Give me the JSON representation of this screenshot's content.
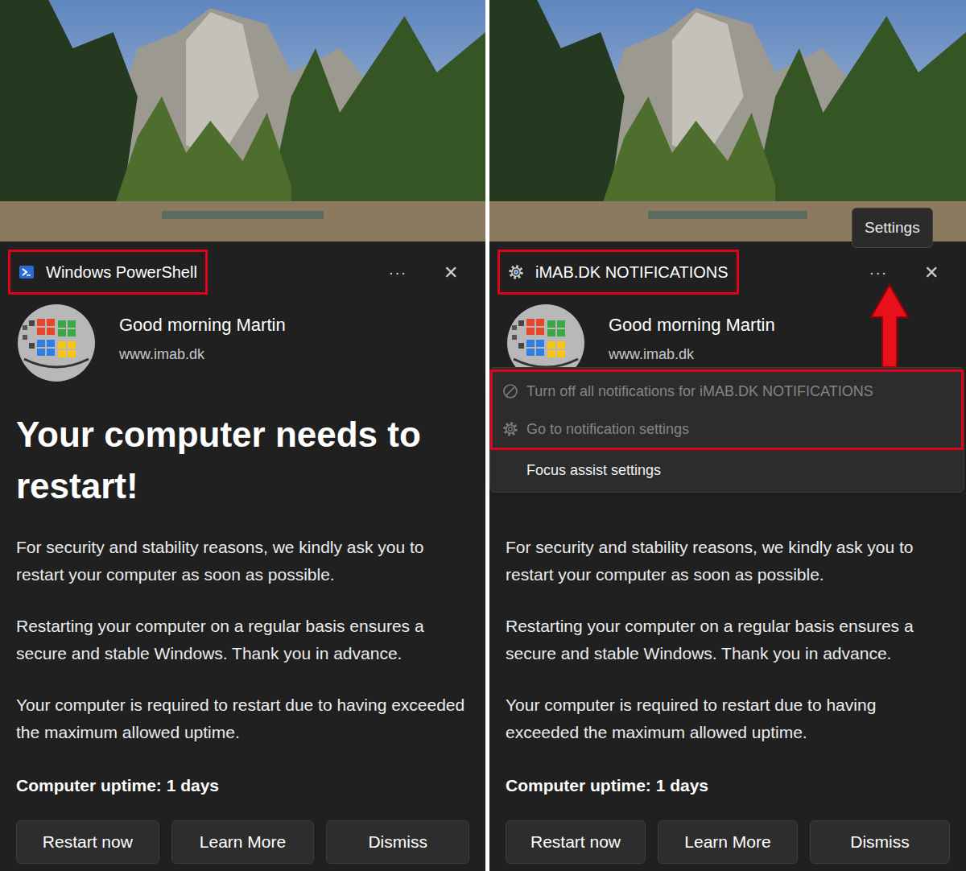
{
  "panels": [
    {
      "kind": "powershell",
      "app_name": "Windows PowerShell",
      "app_highlighted": true,
      "more": "···",
      "close": "✕",
      "sender": "Good morning Martin",
      "site": "www.imab.dk",
      "heading": "Your computer needs to restart!",
      "paragraphs": [
        "For security and stability reasons, we kindly ask you to restart your computer as soon as possible.",
        "Restarting your computer on a regular basis ensures a secure and stable Windows. Thank you in advance.",
        "Your computer is required to restart due to having exceeded the maximum allowed uptime."
      ],
      "uptime_label": "Computer uptime: 1 days",
      "buttons": [
        "Restart now",
        "Learn More",
        "Dismiss"
      ]
    },
    {
      "kind": "gear",
      "app_name": "iMAB.DK NOTIFICATIONS",
      "app_highlighted": true,
      "more": "···",
      "close": "✕",
      "sender": "Good morning Martin",
      "site": "www.imab.dk",
      "paragraphs": [
        "For security and stability reasons, we kindly ask you to restart your computer as soon as possible.",
        "Restarting your computer on a regular basis ensures a secure and stable Windows. Thank you in advance.",
        "Your computer is required to restart due to having exceeded the maximum allowed uptime."
      ],
      "uptime_label": "Computer uptime: 1 days",
      "buttons": [
        "Restart now",
        "Learn More",
        "Dismiss"
      ],
      "tooltip": "Settings",
      "menu": {
        "items": [
          {
            "label": "Turn off all notifications for iMAB.DK NOTIFICATIONS",
            "kind": "block",
            "disabled": true,
            "highlighted": true
          },
          {
            "label": "Go to notification settings",
            "kind": "gear",
            "disabled": true,
            "highlighted": true
          },
          {
            "label": "Focus assist settings",
            "kind": "none",
            "disabled": false,
            "highlighted": false
          }
        ]
      }
    }
  ]
}
